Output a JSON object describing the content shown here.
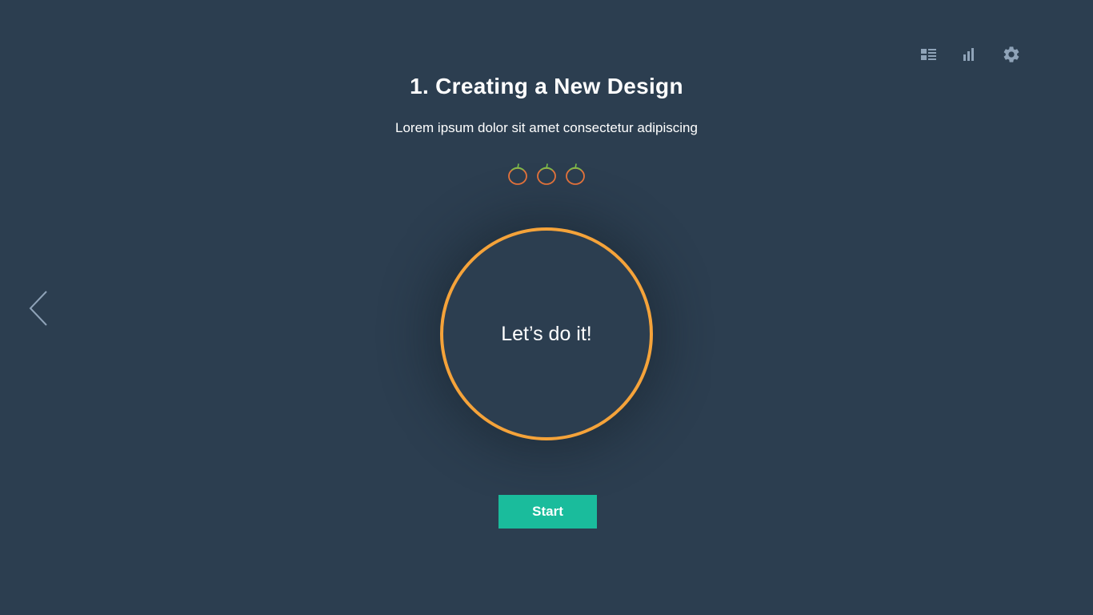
{
  "header": {
    "title": "1. Creating a New Design",
    "subtitle": "Lorem ipsum dolor sit amet consectetur adipiscing"
  },
  "toolbar": {
    "icons": [
      "list-icon",
      "bar-chart-icon",
      "gear-icon"
    ]
  },
  "pomodoros": {
    "count": 3,
    "icon": "tomato-icon"
  },
  "timer": {
    "label": "Let’s do it!"
  },
  "actions": {
    "start_label": "Start"
  },
  "navigation": {
    "back_icon": "chevron-left-icon"
  },
  "colors": {
    "background": "#2c3e50",
    "timer_ring": "#f5a33a",
    "start_button": "#1abc9c",
    "icon": "#8fa3b8",
    "tomato_body": "#e8743b",
    "tomato_leaf": "#7dbf4a"
  }
}
